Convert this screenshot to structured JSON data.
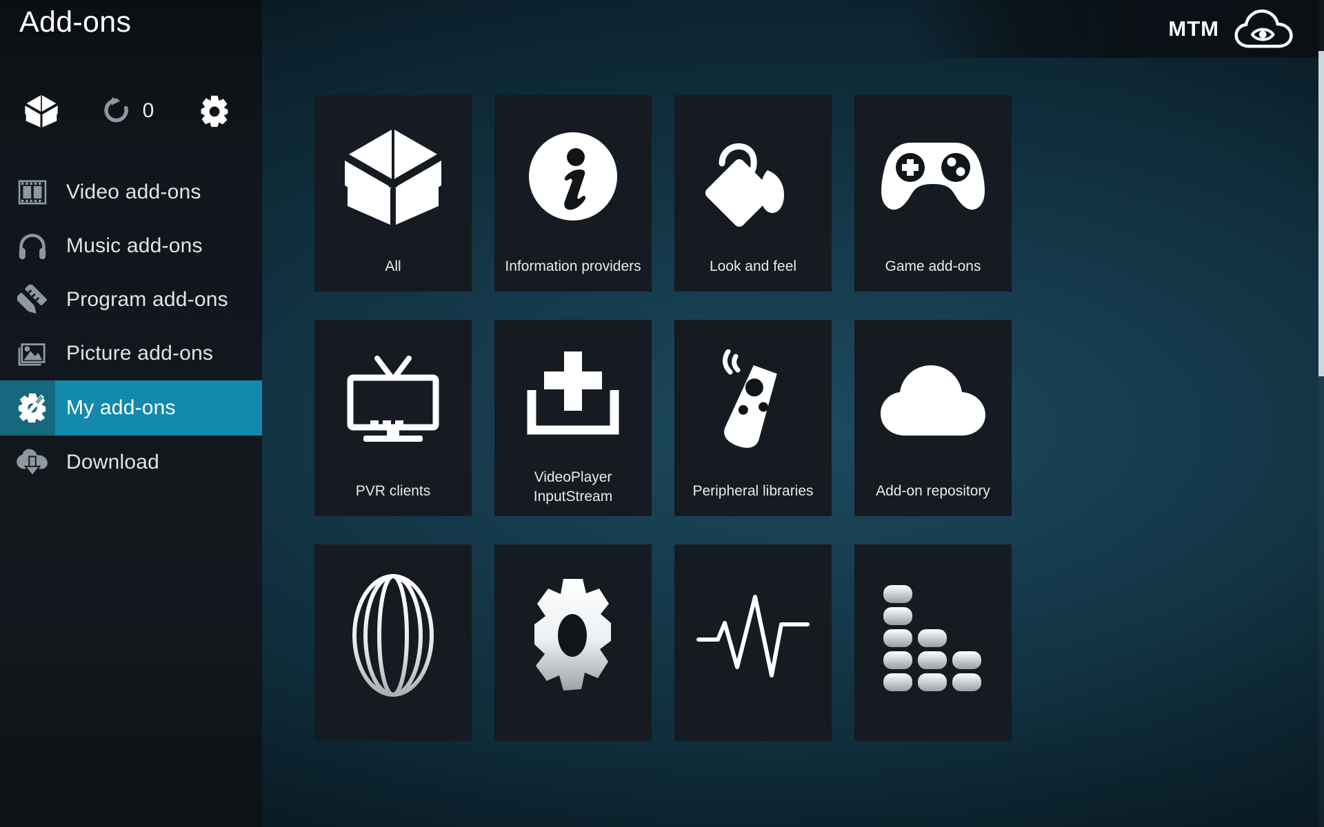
{
  "window": {
    "title": "Add-ons"
  },
  "brand": {
    "text": "MTM",
    "icon": "cloud-eye-icon"
  },
  "toolbar": {
    "items": [
      {
        "name": "install-from-box-button",
        "icon": "open-box-icon",
        "label": ""
      },
      {
        "name": "refresh-button",
        "icon": "refresh-icon",
        "label": ""
      },
      {
        "name": "update-count",
        "icon": "",
        "label": "0"
      },
      {
        "name": "settings-button",
        "icon": "gear-icon",
        "label": ""
      }
    ],
    "update_count": "0"
  },
  "sidebar": {
    "items": [
      {
        "label": "Video add-ons",
        "icon": "film-strip-icon",
        "selected": false
      },
      {
        "label": "Music add-ons",
        "icon": "headphones-icon",
        "selected": false
      },
      {
        "label": "Program add-ons",
        "icon": "pencil-ruler-icon",
        "selected": false
      },
      {
        "label": "Picture add-ons",
        "icon": "photo-icon",
        "selected": false
      },
      {
        "label": "My add-ons",
        "icon": "gear-wrench-icon",
        "selected": true
      },
      {
        "label": "Download",
        "icon": "cloud-download-icon",
        "selected": false
      }
    ]
  },
  "main": {
    "tiles": [
      {
        "label": "All",
        "icon": "open-box-icon",
        "two_line": false
      },
      {
        "label": "Information providers",
        "icon": "info-circle-icon",
        "two_line": false
      },
      {
        "label": "Look and feel",
        "icon": "paint-bucket-icon",
        "two_line": false
      },
      {
        "label": "Game add-ons",
        "icon": "gamepad-icon",
        "two_line": false
      },
      {
        "label": "PVR clients",
        "icon": "tv-icon",
        "two_line": false
      },
      {
        "label": "VideoPlayer\nInputStream",
        "icon": "inbox-plus-icon",
        "two_line": true
      },
      {
        "label": "Peripheral libraries",
        "icon": "remote-control-icon",
        "two_line": false
      },
      {
        "label": "Add-on repository",
        "icon": "cloud-icon",
        "two_line": false
      },
      {
        "label": "",
        "icon": "globe-icon",
        "two_line": false
      },
      {
        "label": "",
        "icon": "gear-solid-icon",
        "two_line": false
      },
      {
        "label": "",
        "icon": "waveform-icon",
        "two_line": false
      },
      {
        "label": "",
        "icon": "equalizer-icon",
        "two_line": false
      }
    ]
  },
  "colors": {
    "selection": "#1389ad",
    "selection_icon": "#16687e",
    "tile_bg": "#151b21",
    "sidebar_bg": "#12181d",
    "text": "#e6ebee",
    "background_teal": "#1d4a5e"
  },
  "scrollbar": {
    "thumb_color": "#cfd6da"
  }
}
